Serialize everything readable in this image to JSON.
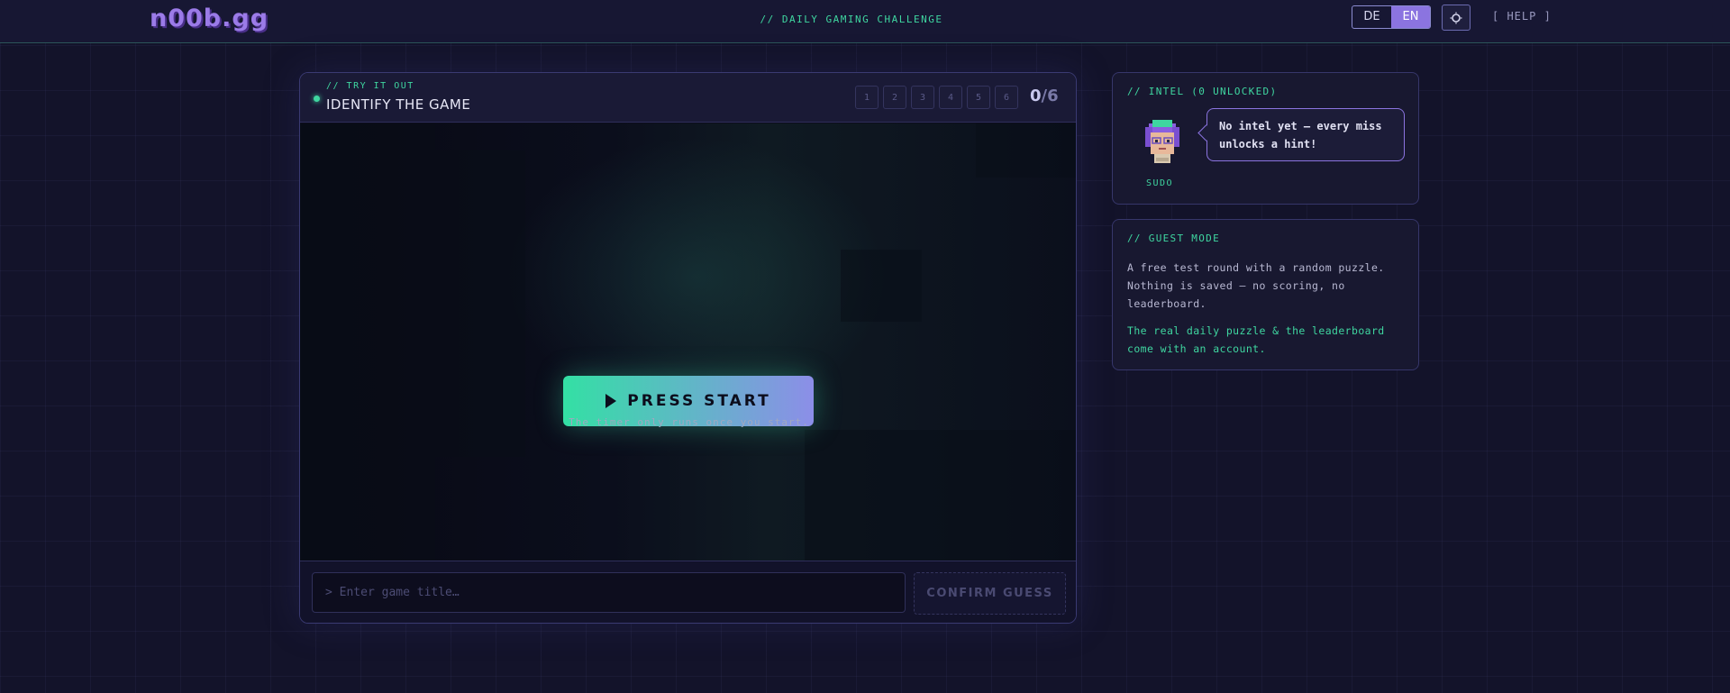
{
  "header": {
    "logo": "n00b.gg",
    "tagline": "// DAILY GAMING CHALLENGE",
    "languages": [
      {
        "label": "DE",
        "active": false
      },
      {
        "label": "EN",
        "active": true
      }
    ],
    "theme_icon": "sun-icon",
    "help_label": "[ HELP ]"
  },
  "game": {
    "eyebrow": "// TRY IT OUT",
    "title": "IDENTIFY THE GAME",
    "steps": [
      "1",
      "2",
      "3",
      "4",
      "5",
      "6"
    ],
    "counter_current": "0",
    "counter_total": "/6",
    "press_start": "PRESS START",
    "play_icon": "play-icon",
    "timer_note": "The timer only runs once you start.",
    "guess_placeholder": "> Enter game title…",
    "guess_value": "",
    "confirm_label": "CONFIRM GUESS"
  },
  "intel": {
    "title": "// INTEL (0 UNLOCKED)",
    "message": "No intel yet — every miss unlocks a hint!",
    "avatar_name": "SUDO"
  },
  "guest": {
    "title": "// GUEST MODE",
    "description": "A free test round with a random puzzle. Nothing is saved — no scoring, no leaderboard.",
    "cta": "The real daily puzzle & the leaderboard come with an account."
  },
  "colors": {
    "accent_green": "#3fd6a0",
    "accent_purple": "#8b74e0",
    "background": "#13132a"
  }
}
